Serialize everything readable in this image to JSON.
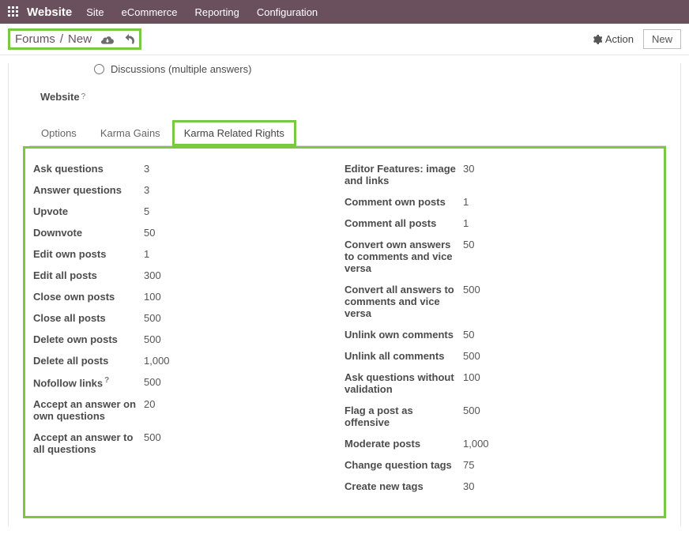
{
  "navbar": {
    "brand": "Website",
    "menu": [
      "Site",
      "eCommerce",
      "Reporting",
      "Configuration"
    ]
  },
  "breadcrumb": {
    "root": "Forums",
    "current": "New"
  },
  "actions": {
    "action_label": "Action",
    "new_label": "New"
  },
  "form": {
    "discussions_label": "Discussions (multiple answers)",
    "website_label": "Website"
  },
  "tabs": {
    "options": "Options",
    "karma_gains": "Karma Gains",
    "karma_rights": "Karma Related Rights"
  },
  "rights_left": [
    {
      "k": "Ask questions",
      "v": "3"
    },
    {
      "k": "Answer questions",
      "v": "3"
    },
    {
      "k": "Upvote",
      "v": "5"
    },
    {
      "k": "Downvote",
      "v": "50"
    },
    {
      "k": "Edit own posts",
      "v": "1"
    },
    {
      "k": "Edit all posts",
      "v": "300"
    },
    {
      "k": "Close own posts",
      "v": "100"
    },
    {
      "k": "Close all posts",
      "v": "500"
    },
    {
      "k": "Delete own posts",
      "v": "500"
    },
    {
      "k": "Delete all posts",
      "v": "1,000"
    },
    {
      "k": "Nofollow links",
      "v": "500",
      "sup": "?"
    },
    {
      "k": "Accept an answer on own questions",
      "v": "20"
    },
    {
      "k": "Accept an answer to all questions",
      "v": "500"
    }
  ],
  "rights_right": [
    {
      "k": "Editor Features: image and links",
      "v": "30"
    },
    {
      "k": "Comment own posts",
      "v": "1"
    },
    {
      "k": "Comment all posts",
      "v": "1"
    },
    {
      "k": "Convert own answers to comments and vice versa",
      "v": "50"
    },
    {
      "k": "Convert all answers to comments and vice versa",
      "v": "500"
    },
    {
      "k": "Unlink own comments",
      "v": "50"
    },
    {
      "k": "Unlink all comments",
      "v": "500"
    },
    {
      "k": "Ask questions without validation",
      "v": "100"
    },
    {
      "k": "Flag a post as offensive",
      "v": "500"
    },
    {
      "k": "Moderate posts",
      "v": "1,000"
    },
    {
      "k": "Change question tags",
      "v": "75"
    },
    {
      "k": "Create new tags",
      "v": "30"
    }
  ]
}
